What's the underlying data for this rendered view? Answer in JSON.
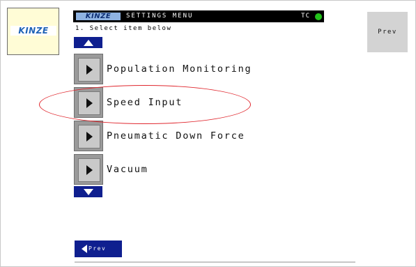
{
  "logo": {
    "text": "KINZE"
  },
  "header": {
    "logo_text": "KINZE",
    "title": "SETTINGS MENU",
    "status_label": "TC",
    "status_color": "#22c21a"
  },
  "instruction": "1. Select item below",
  "prev_top_label": "Prev",
  "scroll": {
    "up_icon": "triangle-up-icon",
    "down_icon": "triangle-down-icon"
  },
  "menu": {
    "items": [
      {
        "label": "Population Monitoring"
      },
      {
        "label": "Speed Input"
      },
      {
        "label": "Pneumatic Down Force"
      },
      {
        "label": "Vacuum"
      }
    ]
  },
  "prev_bottom_label": "Prev",
  "colors": {
    "accent": "#0f1f8f",
    "highlight": "#e0272e",
    "logo_background": "#fffcd6"
  }
}
